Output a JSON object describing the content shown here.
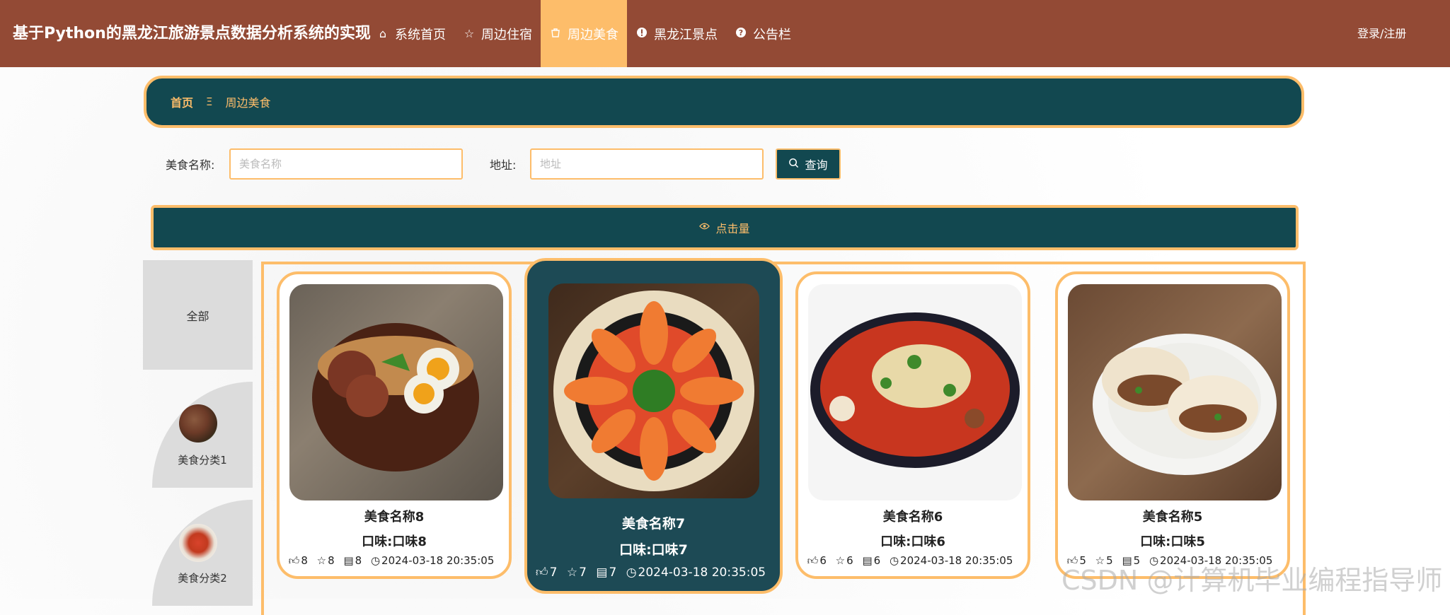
{
  "header": {
    "site_title": "基于Python的黑龙江旅游景点数据分析系统的实现",
    "nav": [
      {
        "label": "系统首页",
        "icon": "home-icon"
      },
      {
        "label": "周边住宿",
        "icon": "star-icon"
      },
      {
        "label": "周边美食",
        "icon": "bag-icon",
        "active": true
      },
      {
        "label": "黑龙江景点",
        "icon": "alert-circle-icon"
      },
      {
        "label": "公告栏",
        "icon": "question-circle-icon"
      }
    ],
    "login_label": "登录/注册"
  },
  "breadcrumb": {
    "home": "首页",
    "separator": "Ξ",
    "current": "周边美食"
  },
  "search": {
    "name_label": "美食名称:",
    "name_placeholder": "美食名称",
    "address_label": "地址:",
    "address_placeholder": "地址",
    "button_label": "查询"
  },
  "sort": {
    "label": "点击量"
  },
  "categories": [
    {
      "label": "全部"
    },
    {
      "label": "美食分类1"
    },
    {
      "label": "美食分类2"
    }
  ],
  "products": [
    {
      "title": "美食名称8",
      "taste": "口味:口味8",
      "likes": "8",
      "favorites": "8",
      "comments": "8",
      "time": "2024-03-18 20:35:05"
    },
    {
      "title": "美食名称7",
      "taste": "口味:口味7",
      "likes": "7",
      "favorites": "7",
      "comments": "7",
      "time": "2024-03-18 20:35:05"
    },
    {
      "title": "美食名称6",
      "taste": "口味:口味6",
      "likes": "6",
      "favorites": "6",
      "comments": "6",
      "time": "2024-03-18 20:35:05"
    },
    {
      "title": "美食名称5",
      "taste": "口味:口味5",
      "likes": "5",
      "favorites": "5",
      "comments": "5",
      "time": "2024-03-18 20:35:05"
    }
  ],
  "colors": {
    "header_bg": "#934a35",
    "accent": "#fdbd6a",
    "dark_teal": "#124850"
  },
  "watermark": "CSDN @计算机毕业编程指导师"
}
